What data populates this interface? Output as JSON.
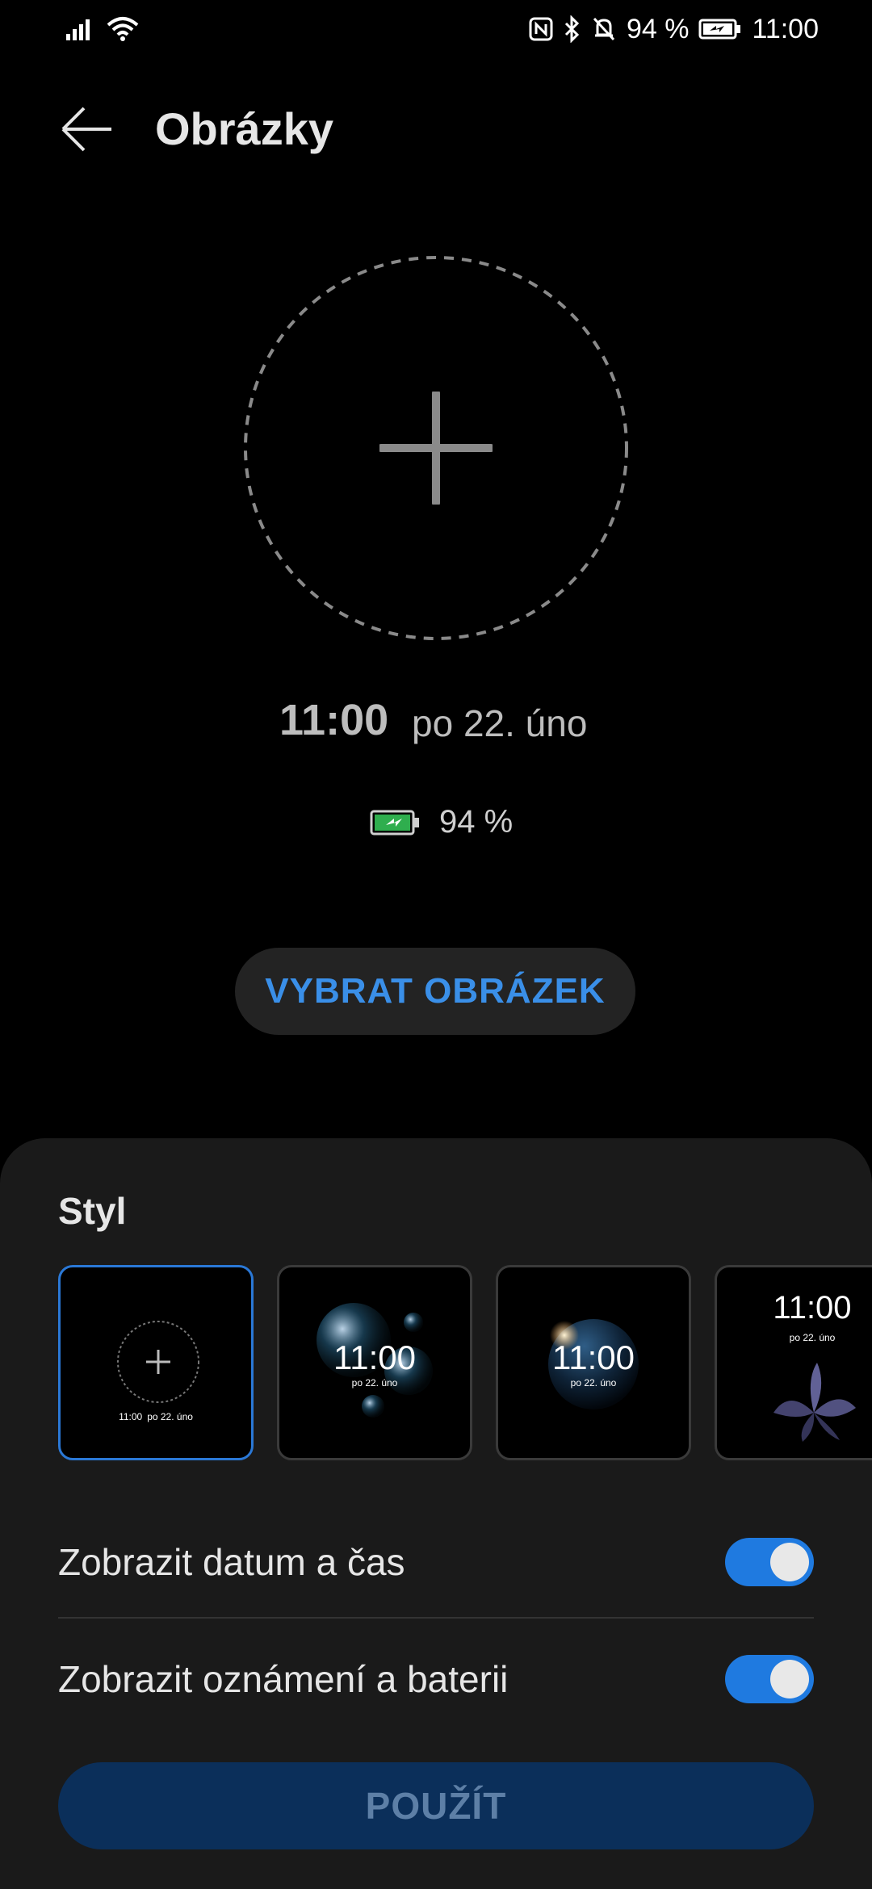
{
  "status_bar": {
    "battery_percent": "94 %",
    "time": "11:00",
    "icons": [
      "signal-icon",
      "wifi-icon",
      "nfc-icon",
      "bluetooth-icon",
      "silent-bell-icon",
      "battery-charging-icon"
    ]
  },
  "header": {
    "title": "Obrázky",
    "back_icon": "arrow-left-icon"
  },
  "preview": {
    "add_icon": "plus-icon",
    "time": "11:00",
    "date": "po 22. úno",
    "battery_text": "94 %"
  },
  "choose_button": {
    "label": "VYBRAT OBRÁZEK"
  },
  "sheet": {
    "section_title": "Styl",
    "styles": [
      {
        "id": "custom",
        "time": "11:00",
        "date": "po 22. úno",
        "selected": true
      },
      {
        "id": "bubbles",
        "time": "11:00",
        "date": "po 22. úno",
        "selected": false
      },
      {
        "id": "planet",
        "time": "11:00",
        "date": "po 22. úno",
        "selected": false
      },
      {
        "id": "flower",
        "time": "11:00",
        "date": "po 22. úno",
        "selected": false
      }
    ],
    "toggles": [
      {
        "label": "Zobrazit datum a čas",
        "on": true
      },
      {
        "label": "Zobrazit oznámení a baterii",
        "on": true
      }
    ],
    "apply_button": {
      "label": "POUŽÍT"
    }
  },
  "colors": {
    "accent": "#3a8fe8",
    "toggle_on": "#1f7ae0",
    "sheet_bg": "#1a1a1a",
    "apply_bg": "#0b2f5a"
  }
}
